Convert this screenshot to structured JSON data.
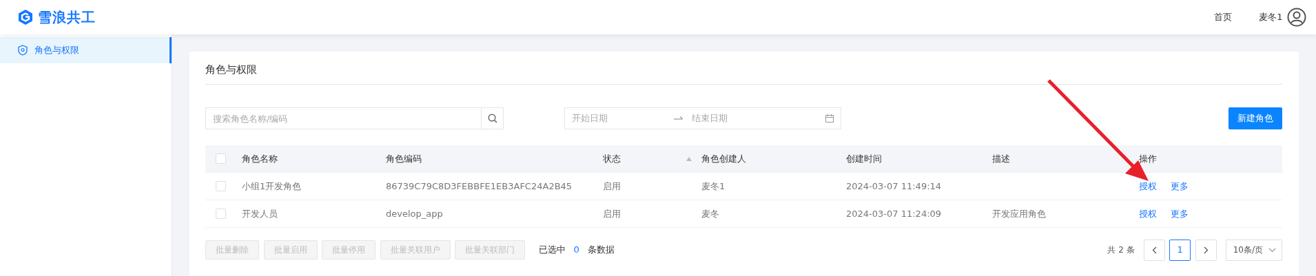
{
  "header": {
    "logo_text": "雪浪共工",
    "nav": [
      {
        "label": "首页"
      }
    ],
    "user_name": "麦冬1"
  },
  "sidebar": {
    "items": [
      {
        "label": "角色与权限",
        "selected": true
      }
    ]
  },
  "page_title": "角色与权限",
  "search": {
    "placeholder": "搜索角色名称/编码"
  },
  "date_range": {
    "start_placeholder": "开始日期",
    "end_placeholder": "结束日期"
  },
  "new_button": "新建角色",
  "table": {
    "select_all_checked": false,
    "columns": [
      {
        "label": "角色名称",
        "sortable": false
      },
      {
        "label": "角色编码",
        "sortable": false
      },
      {
        "label": "状态",
        "sortable": true
      },
      {
        "label": "角色创建人",
        "sortable": false
      },
      {
        "label": "创建时间",
        "sortable": false
      },
      {
        "label": "描述",
        "sortable": false
      },
      {
        "label": "操作",
        "sortable": false
      }
    ],
    "rows": [
      {
        "checked": false,
        "cells": [
          "小组1开发角色",
          "86739C79C8D3FEBBFE1EB3AFC24A2B45",
          "启用",
          "麦冬1",
          "2024-03-07 11:49:14",
          ""
        ],
        "actions": [
          "授权",
          "更多"
        ]
      },
      {
        "checked": false,
        "cells": [
          "开发人员",
          "develop_app",
          "启用",
          "麦冬",
          "2024-03-07 11:24:09",
          "开发应用角色"
        ],
        "actions": [
          "授权",
          "更多"
        ]
      }
    ]
  },
  "batch_buttons": [
    {
      "label": "批量删除",
      "disabled": true
    },
    {
      "label": "批量启用",
      "disabled": true
    },
    {
      "label": "批量停用",
      "disabled": true
    },
    {
      "label": "批量关联用户",
      "disabled": true
    },
    {
      "label": "批量关联部门",
      "disabled": true
    }
  ],
  "selection": {
    "prefix": "已选中",
    "count": "0",
    "suffix": "条数据"
  },
  "pagination": {
    "total": "共 2 条",
    "pages": [
      {
        "label": "1",
        "selected": true
      }
    ],
    "page_size": "10条/页"
  }
}
